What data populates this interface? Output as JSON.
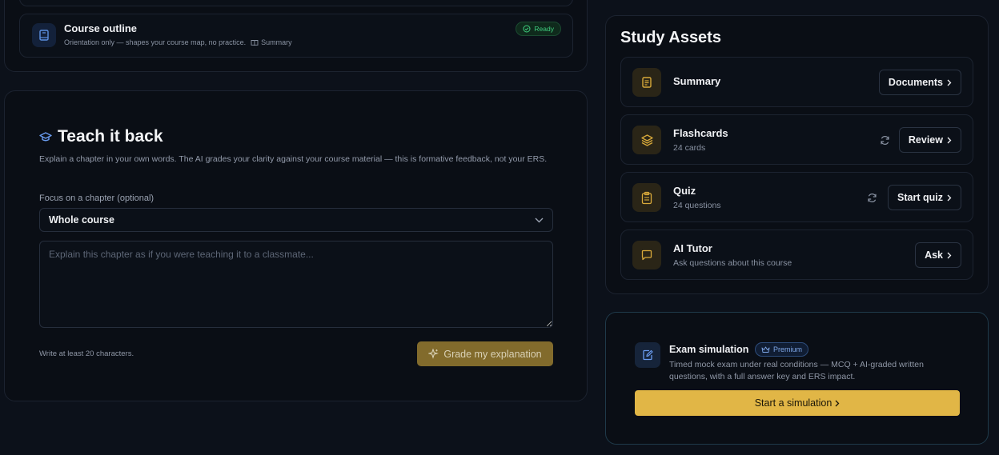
{
  "course_outline": {
    "title": "Course outline",
    "subtitle": "Orientation only — shapes your course map, no practice.",
    "summary_link": "Summary",
    "status": "Ready"
  },
  "teach": {
    "title": "Teach it back",
    "description": "Explain a chapter in your own words. The AI grades your clarity against your course material — this is formative feedback, not your ERS.",
    "focus_label": "Focus on a chapter (optional)",
    "focus_value": "Whole course",
    "textarea_placeholder": "Explain this chapter as if you were teaching it to a classmate...",
    "hint": "Write at least 20 characters.",
    "grade_label": "Grade my explanation"
  },
  "assets": {
    "title": "Study Assets",
    "items": [
      {
        "name": "Summary",
        "sub": "",
        "button": "Documents",
        "icon": "document-icon"
      },
      {
        "name": "Flashcards",
        "sub": "24 cards",
        "button": "Review",
        "icon": "layers-icon"
      },
      {
        "name": "Quiz",
        "sub": "24 questions",
        "button": "Start quiz",
        "icon": "clipboard-icon"
      },
      {
        "name": "AI Tutor",
        "sub": "Ask questions about this course",
        "button": "Ask",
        "icon": "chat-icon"
      }
    ]
  },
  "exam": {
    "title": "Exam simulation",
    "badge": "Premium",
    "description": "Timed mock exam under real conditions — MCQ + AI-graded written questions, with a full answer key and ERS impact.",
    "button": "Start a simulation"
  },
  "colors": {
    "background": "#0c111a",
    "accent_gold": "#e1b646",
    "ready_green": "#3fcf7f",
    "premium_blue": "#7ea6e6"
  }
}
